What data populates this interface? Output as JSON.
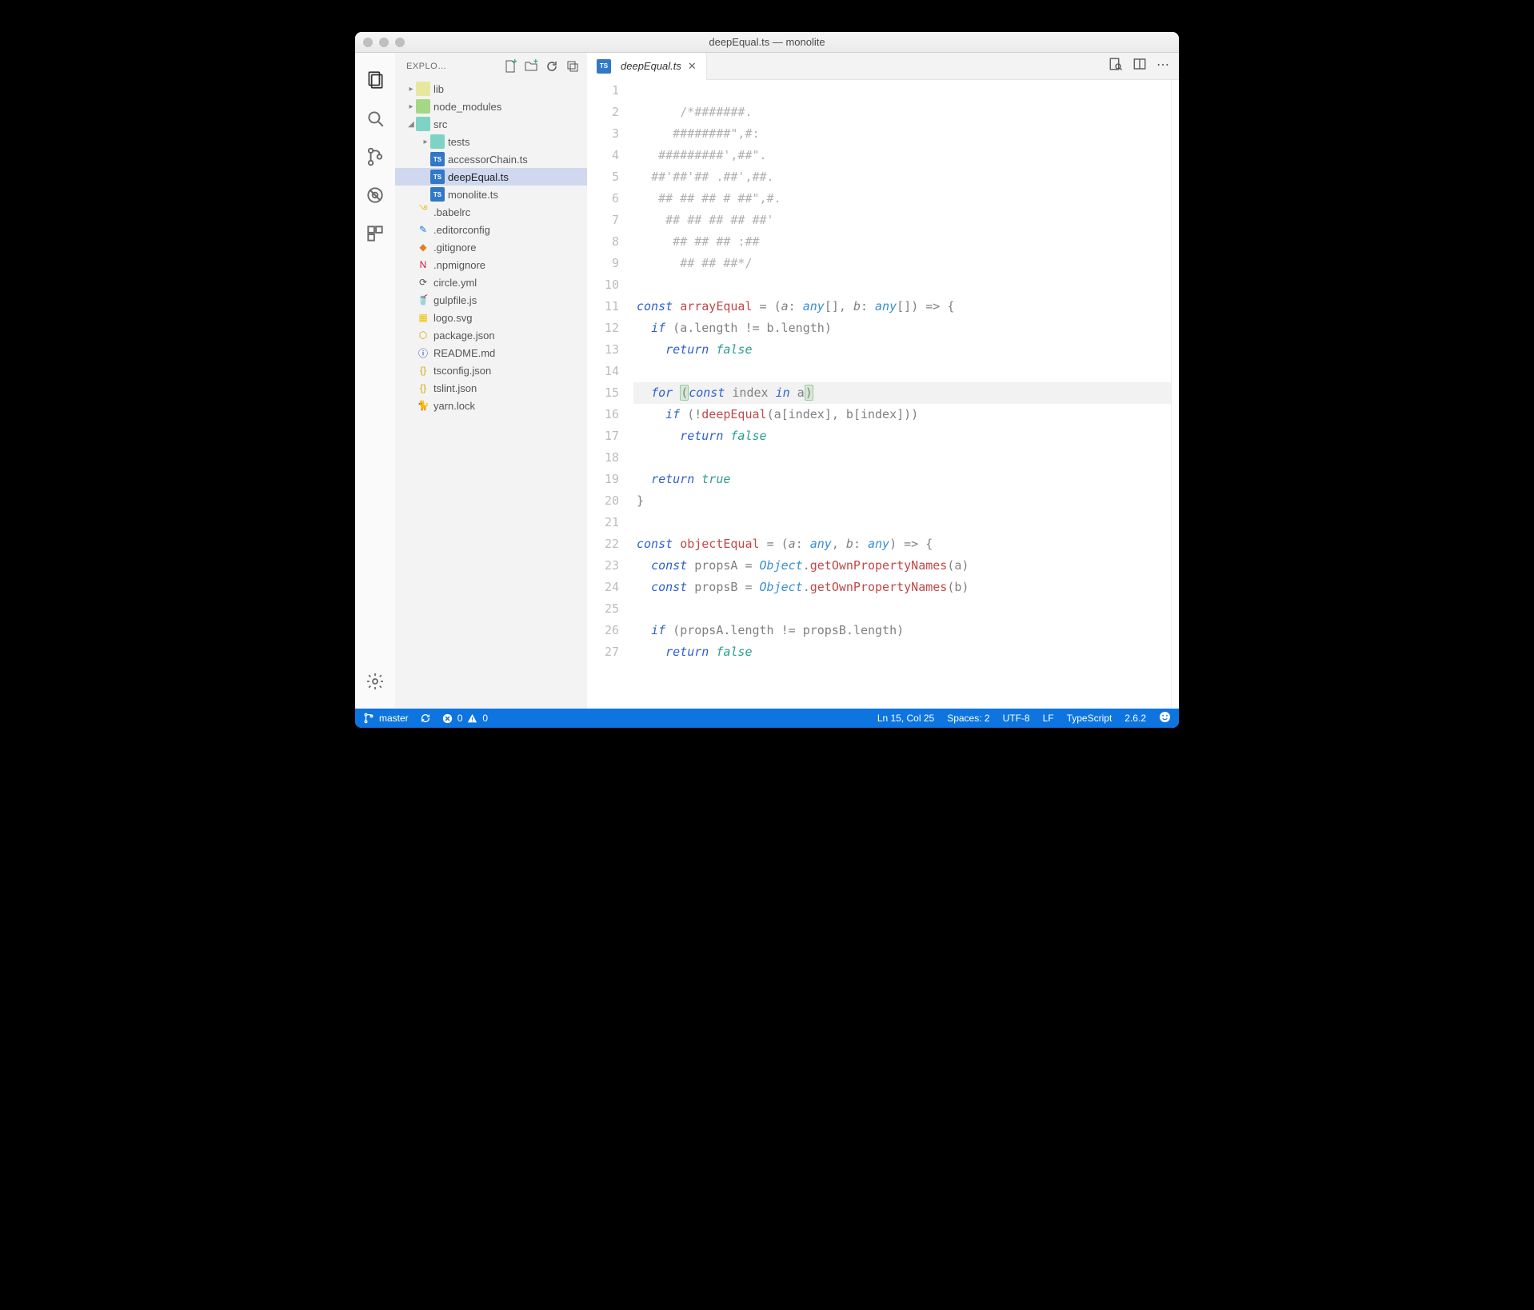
{
  "window": {
    "title": "deepEqual.ts — monolite"
  },
  "sidebar": {
    "title": "EXPLO…",
    "tree": [
      {
        "kind": "folder",
        "name": "lib",
        "depth": 0,
        "expanded": false,
        "icon": "folder"
      },
      {
        "kind": "folder",
        "name": "node_modules",
        "depth": 0,
        "expanded": false,
        "icon": "folder green"
      },
      {
        "kind": "folder",
        "name": "src",
        "depth": 0,
        "expanded": true,
        "icon": "folder teal"
      },
      {
        "kind": "folder",
        "name": "tests",
        "depth": 1,
        "expanded": false,
        "icon": "folder teal"
      },
      {
        "kind": "file",
        "name": "accessorChain.ts",
        "depth": 1,
        "icon": "ts",
        "iconText": "TS"
      },
      {
        "kind": "file",
        "name": "deepEqual.ts",
        "depth": 1,
        "icon": "ts",
        "iconText": "TS",
        "selected": true
      },
      {
        "kind": "file",
        "name": "monolite.ts",
        "depth": 1,
        "icon": "ts",
        "iconText": "TS"
      },
      {
        "kind": "file",
        "name": ".babelrc",
        "depth": 0,
        "icon": "yellow",
        "iconText": "࿓"
      },
      {
        "kind": "file",
        "name": ".editorconfig",
        "depth": 0,
        "icon": "blue",
        "iconText": "✎"
      },
      {
        "kind": "file",
        "name": ".gitignore",
        "depth": 0,
        "icon": "orange",
        "iconText": "◆"
      },
      {
        "kind": "file",
        "name": ".npmignore",
        "depth": 0,
        "icon": "red",
        "iconText": "N"
      },
      {
        "kind": "file",
        "name": "circle.yml",
        "depth": 0,
        "icon": "",
        "iconText": "⟳"
      },
      {
        "kind": "file",
        "name": "gulpfile.js",
        "depth": 0,
        "icon": "js",
        "iconText": "🥤"
      },
      {
        "kind": "file",
        "name": "logo.svg",
        "depth": 0,
        "icon": "svg",
        "iconText": "▦"
      },
      {
        "kind": "file",
        "name": "package.json",
        "depth": 0,
        "icon": "json",
        "iconText": "⬡"
      },
      {
        "kind": "file",
        "name": "README.md",
        "depth": 0,
        "icon": "cyan",
        "iconText": "ⓘ"
      },
      {
        "kind": "file",
        "name": "tsconfig.json",
        "depth": 0,
        "icon": "json",
        "iconText": "{}"
      },
      {
        "kind": "file",
        "name": "tslint.json",
        "depth": 0,
        "icon": "json",
        "iconText": "{}"
      },
      {
        "kind": "file",
        "name": "yarn.lock",
        "depth": 0,
        "icon": "blue",
        "iconText": "🐈"
      }
    ]
  },
  "tabs": {
    "open": [
      {
        "name": "deepEqual.ts",
        "icon": "ts",
        "iconText": "TS"
      }
    ]
  },
  "editor": {
    "lines": [
      {
        "n": 1,
        "html": ""
      },
      {
        "n": 2,
        "html": "      <span class='cmt'>/*#######.</span>"
      },
      {
        "n": 3,
        "html": "     <span class='cmt'>########\",#:</span>"
      },
      {
        "n": 4,
        "html": "   <span class='cmt'>#########',##\".</span>"
      },
      {
        "n": 5,
        "html": "  <span class='cmt'>##'##'## .##',##.</span>"
      },
      {
        "n": 6,
        "html": "   <span class='cmt'>## ## ## # ##\",#.</span>"
      },
      {
        "n": 7,
        "html": "    <span class='cmt'>## ## ## ## ##'</span>"
      },
      {
        "n": 8,
        "html": "     <span class='cmt'>## ## ## :##</span>"
      },
      {
        "n": 9,
        "html": "      <span class='cmt'>## ## ##*/</span>"
      },
      {
        "n": 10,
        "html": ""
      },
      {
        "n": 11,
        "html": "<span class='kw'>const</span> <span class='fn'>arrayEqual</span> <span class='op'>=</span> <span class='punct'>(</span><span class='param'>a</span><span class='punct'>:</span> <span class='type'>any</span><span class='punct'>[]</span><span class='punct'>,</span> <span class='param'>b</span><span class='punct'>:</span> <span class='type'>any</span><span class='punct'>[]</span><span class='punct'>)</span> <span class='op'>=&gt;</span> <span class='punct'>{</span>"
      },
      {
        "n": 12,
        "html": "  <span class='kw'>if</span> <span class='punct'>(</span>a<span class='punct'>.</span>length <span class='op'>!=</span> b<span class='punct'>.</span>length<span class='punct'>)</span>"
      },
      {
        "n": 13,
        "html": "    <span class='kw'>return</span> <span class='bool'>false</span>"
      },
      {
        "n": 14,
        "html": ""
      },
      {
        "n": 15,
        "hl": true,
        "html": "  <span class='kw'>for</span> <span class='bracket punct'>(</span><span class='kw'>const</span> index <span class='kw'>in</span> a<span class='bracket punct'>)</span>"
      },
      {
        "n": 16,
        "html": "    <span class='kw'>if</span> <span class='punct'>(</span><span class='op'>!</span><span class='fn'>deepEqual</span><span class='punct'>(</span>a<span class='punct'>[</span>index<span class='punct'>]</span><span class='punct'>,</span> b<span class='punct'>[</span>index<span class='punct'>]</span><span class='punct'>)</span><span class='punct'>)</span>"
      },
      {
        "n": 17,
        "html": "      <span class='kw'>return</span> <span class='bool'>false</span>"
      },
      {
        "n": 18,
        "html": ""
      },
      {
        "n": 19,
        "html": "  <span class='kw'>return</span> <span class='bool'>true</span>"
      },
      {
        "n": 20,
        "html": "<span class='punct'>}</span>"
      },
      {
        "n": 21,
        "html": ""
      },
      {
        "n": 22,
        "html": "<span class='kw'>const</span> <span class='fn'>objectEqual</span> <span class='op'>=</span> <span class='punct'>(</span><span class='param'>a</span><span class='punct'>:</span> <span class='type'>any</span><span class='punct'>,</span> <span class='param'>b</span><span class='punct'>:</span> <span class='type'>any</span><span class='punct'>)</span> <span class='op'>=&gt;</span> <span class='punct'>{</span>"
      },
      {
        "n": 23,
        "html": "  <span class='kw'>const</span> propsA <span class='op'>=</span> <span class='obj'>Object</span><span class='punct'>.</span><span class='prop'>getOwnPropertyNames</span><span class='punct'>(</span>a<span class='punct'>)</span>"
      },
      {
        "n": 24,
        "html": "  <span class='kw'>const</span> propsB <span class='op'>=</span> <span class='obj'>Object</span><span class='punct'>.</span><span class='prop'>getOwnPropertyNames</span><span class='punct'>(</span>b<span class='punct'>)</span>"
      },
      {
        "n": 25,
        "html": ""
      },
      {
        "n": 26,
        "html": "  <span class='kw'>if</span> <span class='punct'>(</span>propsA<span class='punct'>.</span>length <span class='op'>!=</span> propsB<span class='punct'>.</span>length<span class='punct'>)</span>"
      },
      {
        "n": 27,
        "html": "    <span class='kw'>return</span> <span class='bool'>false</span>"
      }
    ]
  },
  "status": {
    "branch": "master",
    "errors": "0",
    "warnings": "0",
    "cursor": "Ln 15, Col 25",
    "indent": "Spaces: 2",
    "encoding": "UTF-8",
    "eol": "LF",
    "language": "TypeScript",
    "version": "2.6.2"
  }
}
